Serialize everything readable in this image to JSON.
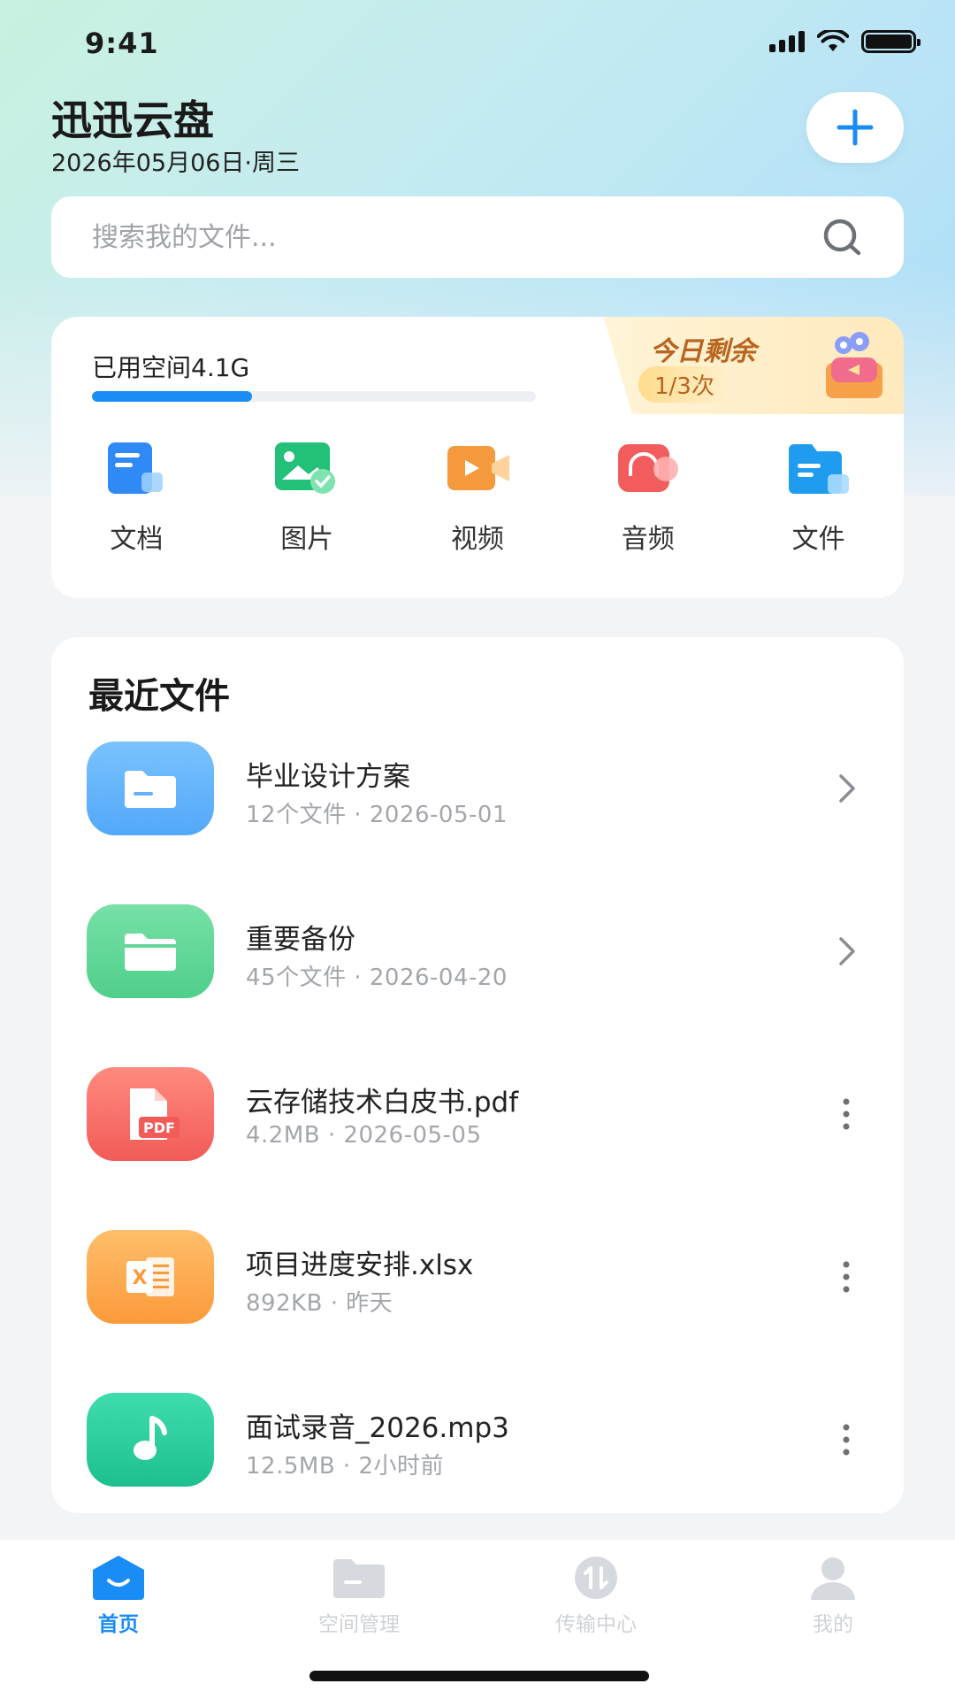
{
  "status_bar": {
    "time": "9:41"
  },
  "header": {
    "title": "迅迅云盘",
    "date": "2026年05月06日·周三"
  },
  "search": {
    "placeholder": "搜索我的文件..."
  },
  "storage": {
    "used_label": "已用空间4.1G",
    "progress_fraction": 0.36,
    "quota_title": "今日剩余",
    "quota_count": "1/3次"
  },
  "categories": [
    {
      "label": "文档",
      "icon": "document-icon",
      "color": "#2f8af5"
    },
    {
      "label": "图片",
      "icon": "image-icon",
      "color": "#23c07a"
    },
    {
      "label": "视频",
      "icon": "video-icon",
      "color": "#f59a3c"
    },
    {
      "label": "音频",
      "icon": "audio-icon",
      "color": "#f35c5c"
    },
    {
      "label": "文件",
      "icon": "folder-icon",
      "color": "#1f9cf0"
    }
  ],
  "recent": {
    "title": "最近文件",
    "items": [
      {
        "name": "毕业设计方案",
        "meta": "12个文件 · 2026-05-01",
        "icon": "folder-icon",
        "action": "chevron-right-icon"
      },
      {
        "name": "重要备份",
        "meta": "45个文件 · 2026-04-20",
        "icon": "folder-icon",
        "action": "chevron-right-icon"
      },
      {
        "name": "云存储技术白皮书.pdf",
        "meta": "4.2MB · 2026-05-05",
        "icon": "pdf-icon",
        "action": "more-vertical-icon"
      },
      {
        "name": "项目进度安排.xlsx",
        "meta": "892KB · 昨天",
        "icon": "excel-icon",
        "action": "more-vertical-icon"
      },
      {
        "name": "面试录音_2026.mp3",
        "meta": "12.5MB · 2小时前",
        "icon": "music-icon",
        "action": "more-vertical-icon"
      }
    ]
  },
  "tabs": [
    {
      "label": "首页",
      "icon": "home-icon",
      "active": true
    },
    {
      "label": "空间管理",
      "icon": "folder-icon"
    },
    {
      "label": "传输中心",
      "icon": "transfer-icon"
    },
    {
      "label": "我的",
      "icon": "user-icon"
    }
  ],
  "colors": {
    "accent": "#1a8cf5",
    "quota_text": "#b8651f"
  }
}
